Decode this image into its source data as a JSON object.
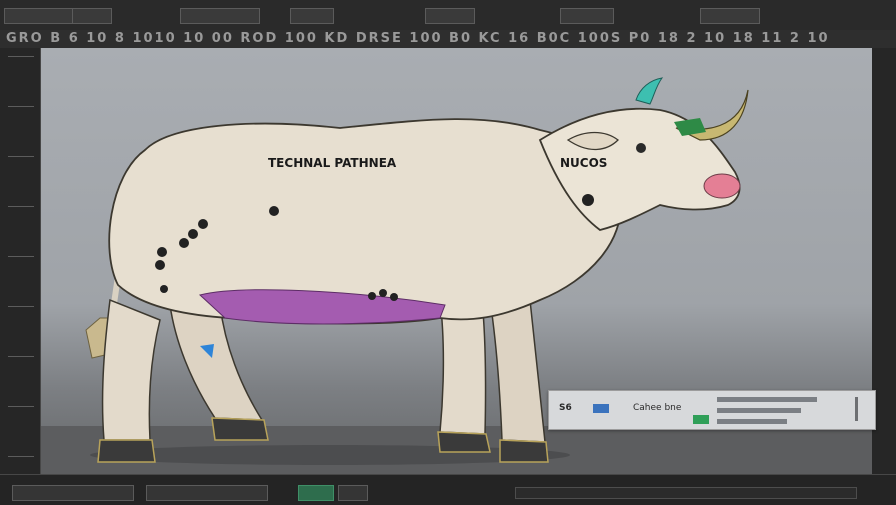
{
  "window": {
    "top_segments": [
      "",
      "",
      "",
      "",
      "",
      "",
      ""
    ],
    "ruler_text": "GRO  B  6 10  8 1010 10 00 ROD 100 KD DRSE 100 B0 KC 16 B0C 100S P0 18 2  10 18 11 2   10"
  },
  "canvas": {
    "label_main": "TECHNAL PATHNEA",
    "label_main_accent": "",
    "label_neck": "NUCOS"
  },
  "info_panel": {
    "icon_text": "S6",
    "label": "Cahee  bne",
    "rows": [
      "",
      "",
      ""
    ]
  },
  "colors": {
    "cow_body": "#e7dfd0",
    "cow_shadow": "#c7bba8",
    "udder": "#a45cb0",
    "nose": "#e47f95",
    "horn": "#c8b872",
    "canvas_bg": "#a5a9ae",
    "accent_green": "#2e6d4d"
  },
  "icons": {
    "horn_tip": "teal-leaf-icon",
    "hoof": "hoof-icon",
    "leg_marker": "blue-marker-icon"
  }
}
